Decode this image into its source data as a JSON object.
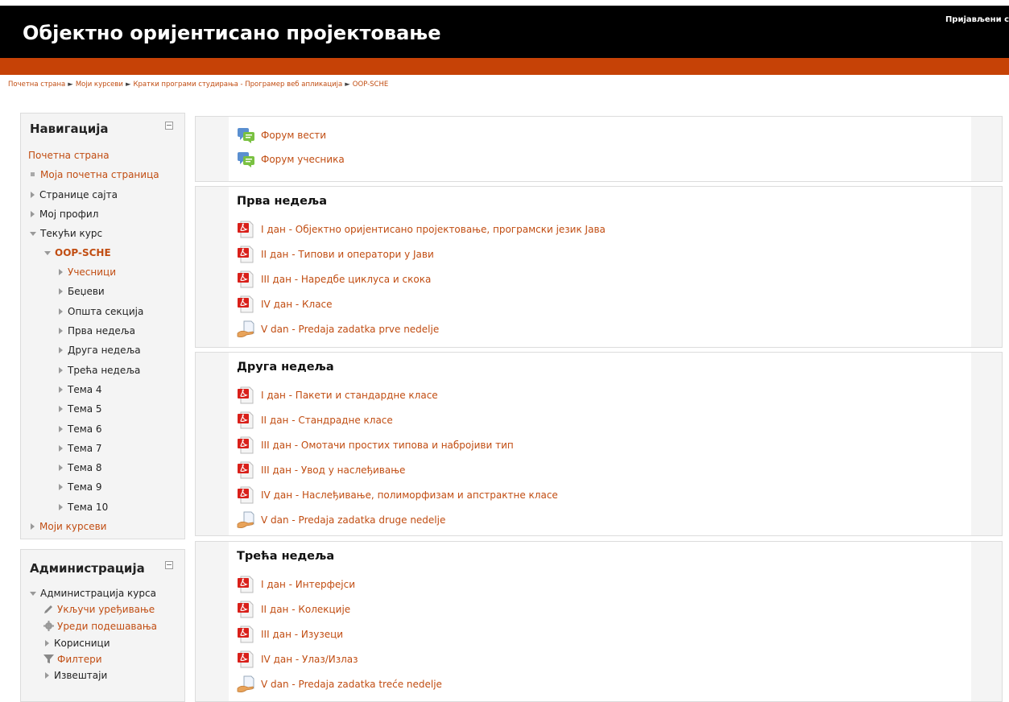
{
  "header": {
    "site_title": "Објектно оријентисано пројектовање",
    "login_info": "Пријављени с"
  },
  "breadcrumb": {
    "items": [
      "Почетна страна",
      "Моји курсеви",
      "Кратки програми студирања - Програмер веб апликација",
      "OOP-SCHE"
    ],
    "separator": "►"
  },
  "navigation": {
    "title": "Навигација",
    "home": "Почетна страна",
    "my_home": "Моја почетна страница",
    "site_pages": "Странице сајта",
    "my_profile": "Мој профил",
    "current_course": "Текући курс",
    "course_code": "OOP-SCHE",
    "course_items": [
      "Учесници",
      "Беџеви",
      "Општа секција",
      "Прва недеља",
      "Друга недеља",
      "Трећа недеља",
      "Тема 4",
      "Тема 5",
      "Тема 6",
      "Тема 7",
      "Тема 8",
      "Тема 9",
      "Тема 10"
    ],
    "my_courses": "Моји курсеви"
  },
  "administration": {
    "title": "Администрација",
    "course_admin": "Администрација курса",
    "turn_editing_on": "Укључи уређивање",
    "edit_settings": "Уреди подешавања",
    "users": "Корисници",
    "filters": "Филтери",
    "reports": "Извештаји"
  },
  "sections": {
    "general": {
      "activities": [
        {
          "label": "Форум вести",
          "icon": "forum-icon"
        },
        {
          "label": "Форум учесника",
          "icon": "forum-icon"
        }
      ]
    },
    "week1": {
      "title": "Прва недеља",
      "activities": [
        {
          "label": "I дан - Објектно оријентисано пројектовање, програмски језик Јава",
          "icon": "pdf-icon"
        },
        {
          "label": "II дан - Типови и оператори у Јави",
          "icon": "pdf-icon"
        },
        {
          "label": "III дан - Наредбе циклуса и скока",
          "icon": "pdf-icon"
        },
        {
          "label": "IV дан - Класе",
          "icon": "pdf-icon"
        },
        {
          "label": "V dan - Predaja zadatka prve nedelje",
          "icon": "assignment-icon"
        }
      ]
    },
    "week2": {
      "title": "Друга недеља",
      "activities": [
        {
          "label": "I дан - Пакети и стандардне класе",
          "icon": "pdf-icon"
        },
        {
          "label": "II дан - Стандрадне класе",
          "icon": "pdf-icon"
        },
        {
          "label": "III дан - Омотачи простих типова и набројиви тип",
          "icon": "pdf-icon"
        },
        {
          "label": "III дан - Увод у наслеђивање",
          "icon": "pdf-icon"
        },
        {
          "label": "IV дан - Наслеђивање, полиморфизам и апстрактне класе",
          "icon": "pdf-icon"
        },
        {
          "label": "V dan - Predaja zadatka druge nedelje",
          "icon": "assignment-icon"
        }
      ]
    },
    "week3": {
      "title": "Трећа недеља",
      "activities": [
        {
          "label": "I дан - Интерфејси",
          "icon": "pdf-icon"
        },
        {
          "label": "II дан - Колекције",
          "icon": "pdf-icon"
        },
        {
          "label": "III дан - Изузеци",
          "icon": "pdf-icon"
        },
        {
          "label": "IV дан - Улаз/Излаз",
          "icon": "pdf-icon"
        },
        {
          "label": "V dan - Predaja zadatka treće nedelje",
          "icon": "assignment-icon"
        }
      ]
    }
  },
  "colors": {
    "header_bg": "#000000",
    "accent_bar": "#c64206",
    "link": "#c14d12"
  }
}
